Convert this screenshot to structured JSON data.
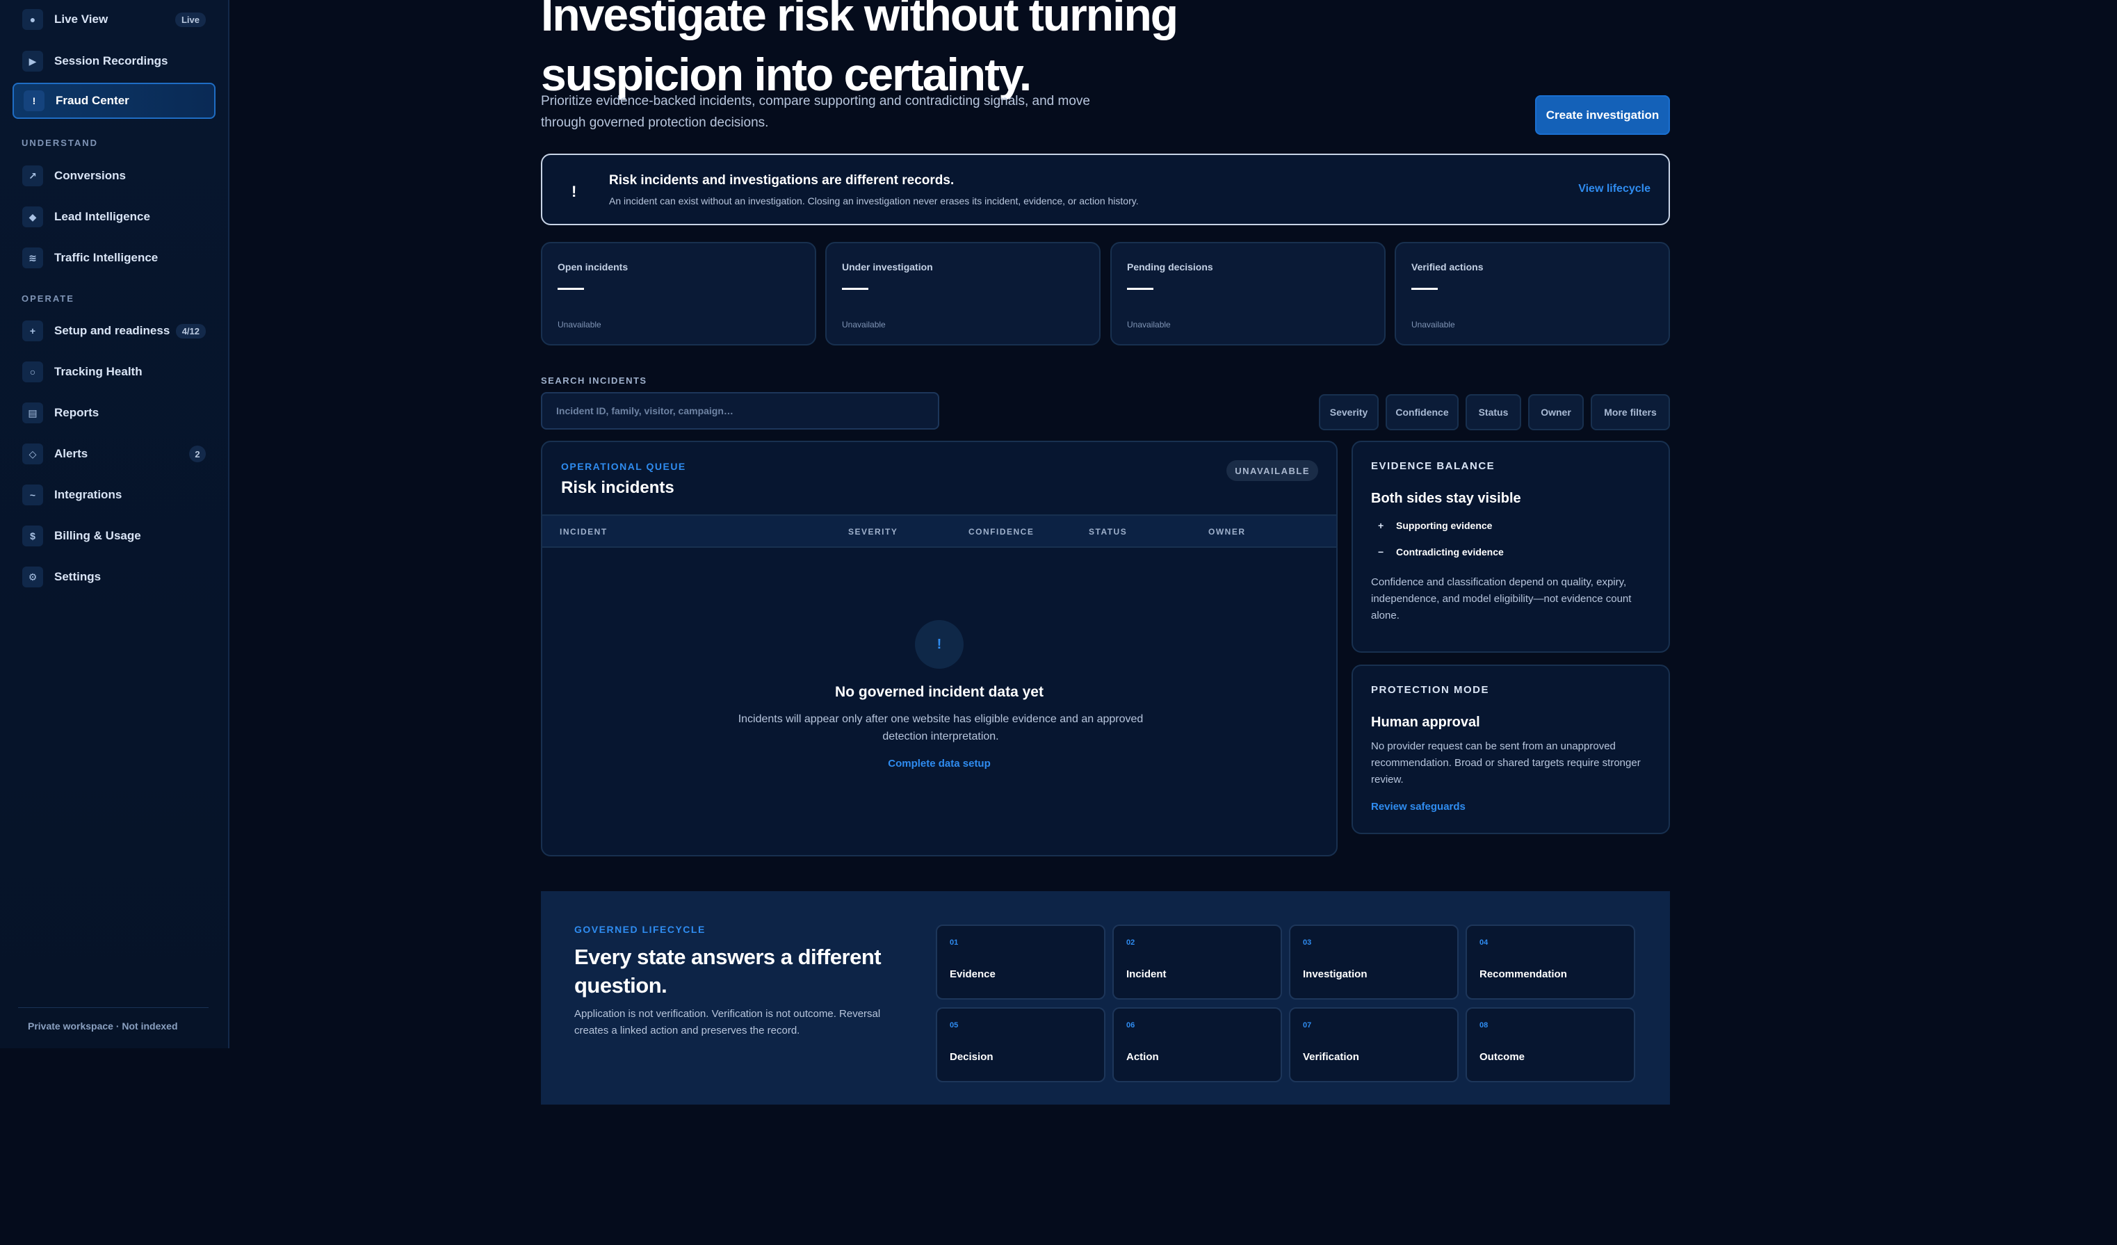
{
  "sidebar": {
    "items": [
      {
        "label": "Live View",
        "icon": "dot-icon",
        "glyph": "●",
        "badge": "Live"
      },
      {
        "label": "Session Recordings",
        "icon": "play-icon",
        "glyph": "▶"
      },
      {
        "label": "Fraud Center",
        "icon": "exclamation-icon",
        "glyph": "!"
      },
      {
        "label": "Conversions",
        "icon": "trend-arrow-icon",
        "glyph": "↗"
      },
      {
        "label": "Lead Intelligence",
        "icon": "diamond-icon",
        "glyph": "◆"
      },
      {
        "label": "Traffic Intelligence",
        "icon": "waves-icon",
        "glyph": "≋"
      },
      {
        "label": "Setup and readiness",
        "icon": "plus-icon",
        "glyph": "+",
        "badge": "4/12"
      },
      {
        "label": "Tracking Health",
        "icon": "circle-icon",
        "glyph": "○"
      },
      {
        "label": "Reports",
        "icon": "report-icon",
        "glyph": "▤"
      },
      {
        "label": "Alerts",
        "icon": "alert-diamond-icon",
        "glyph": "◇",
        "badge": "2"
      },
      {
        "label": "Integrations",
        "icon": "link-icon",
        "glyph": "~"
      },
      {
        "label": "Billing & Usage",
        "icon": "dollar-icon",
        "glyph": "$"
      },
      {
        "label": "Settings",
        "icon": "gear-icon",
        "glyph": "⚙"
      }
    ],
    "sections": [
      "UNDERSTAND",
      "OPERATE"
    ],
    "footer": "Private workspace · Not indexed",
    "active_item": "Fraud Center"
  },
  "header": {
    "title": "Investigate risk without turning suspicion into certainty.",
    "subtitle": "Prioritize evidence-backed incidents, compare supporting and contradicting signals, and move through governed protection decisions.",
    "create_button": "Create investigation"
  },
  "notice": {
    "icon_glyph": "!",
    "title": "Risk incidents and investigations are different records.",
    "text": "An incident can exist without an investigation. Closing an investigation never erases its incident, evidence, or action history.",
    "link": "View lifecycle"
  },
  "stats": [
    {
      "label": "Open incidents",
      "status": "Unavailable"
    },
    {
      "label": "Under investigation",
      "status": "Unavailable"
    },
    {
      "label": "Pending decisions",
      "status": "Unavailable"
    },
    {
      "label": "Verified actions",
      "status": "Unavailable"
    }
  ],
  "search": {
    "label": "SEARCH INCIDENTS",
    "placeholder": "Incident ID, family, visitor, campaign…",
    "filters": [
      "Severity",
      "Confidence",
      "Status",
      "Owner",
      "More filters"
    ]
  },
  "queue": {
    "eyebrow": "OPERATIONAL QUEUE",
    "title": "Risk incidents",
    "badge": "UNAVAILABLE",
    "columns": [
      "INCIDENT",
      "SEVERITY",
      "CONFIDENCE",
      "STATUS",
      "OWNER"
    ],
    "empty": {
      "icon_glyph": "!",
      "title": "No governed incident data yet",
      "text": "Incidents will appear only after one website has eligible evidence and an approved detection interpretation.",
      "link": "Complete data setup"
    }
  },
  "evidence_balance": {
    "eyebrow": "EVIDENCE BALANCE",
    "title": "Both sides stay visible",
    "items": [
      {
        "sign": "+",
        "label": "Supporting evidence"
      },
      {
        "sign": "−",
        "label": "Contradicting evidence"
      }
    ],
    "text": "Confidence and classification depend on quality, expiry, independence, and model eligibility—not evidence count alone."
  },
  "protection_mode": {
    "eyebrow": "PROTECTION MODE",
    "title": "Human approval",
    "text": "No provider request can be sent from an unapproved recommendation. Broad or shared targets require stronger review.",
    "link": "Review safeguards"
  },
  "lifecycle": {
    "eyebrow": "GOVERNED LIFECYCLE",
    "title": "Every state answers a different question.",
    "text": "Application is not verification. Verification is not outcome. Reversal creates a linked action and preserves the record.",
    "steps": [
      {
        "num": "01",
        "name": "Evidence"
      },
      {
        "num": "02",
        "name": "Incident"
      },
      {
        "num": "03",
        "name": "Investigation"
      },
      {
        "num": "04",
        "name": "Recommendation"
      },
      {
        "num": "05",
        "name": "Decision"
      },
      {
        "num": "06",
        "name": "Action"
      },
      {
        "num": "07",
        "name": "Verification"
      },
      {
        "num": "08",
        "name": "Outcome"
      }
    ]
  },
  "colors": {
    "background": "#050c1c",
    "accent": "#2f8cf0",
    "primary_button": "#1461b8",
    "card": "#071630"
  }
}
